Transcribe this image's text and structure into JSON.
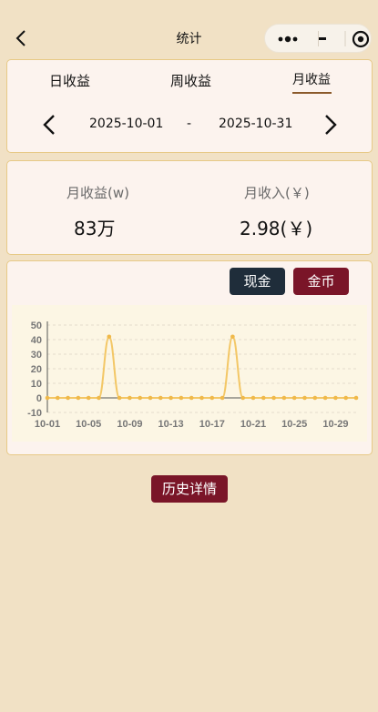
{
  "navbar": {
    "title": "统计",
    "icons": [
      "back-chevron-icon",
      "more-dots-icon",
      "minimize-icon",
      "close-target-icon"
    ]
  },
  "tabs": [
    {
      "label": "日收益",
      "active": false
    },
    {
      "label": "周收益",
      "active": false
    },
    {
      "label": "月收益",
      "active": true
    }
  ],
  "date_range": {
    "start": "2025-10-01",
    "separator": "-",
    "end": "2025-10-31"
  },
  "stats": {
    "left_label": "月收益(w)",
    "left_value": "83万",
    "right_label": "月收入(￥)",
    "right_value": "2.98(￥)"
  },
  "toggle": {
    "cash_label": "现金",
    "coin_label": "金币"
  },
  "chart_data": {
    "type": "line",
    "x": [
      "10-01",
      "10-02",
      "10-03",
      "10-04",
      "10-05",
      "10-06",
      "10-07",
      "10-08",
      "10-09",
      "10-10",
      "10-11",
      "10-12",
      "10-13",
      "10-14",
      "10-15",
      "10-16",
      "10-17",
      "10-18",
      "10-19",
      "10-20",
      "10-21",
      "10-22",
      "10-23",
      "10-24",
      "10-25",
      "10-26",
      "10-27",
      "10-28",
      "10-29",
      "10-30",
      "10-31"
    ],
    "series": [
      {
        "values": [
          0,
          0,
          0,
          0,
          0,
          0,
          42,
          0,
          0,
          0,
          0,
          0,
          0,
          0,
          0,
          0,
          0,
          0,
          42,
          0,
          0,
          0,
          0,
          0,
          0,
          0,
          0,
          0,
          0,
          0,
          0
        ]
      }
    ],
    "xticks": [
      "10-01",
      "10-05",
      "10-09",
      "10-13",
      "10-17",
      "10-21",
      "10-25",
      "10-29"
    ],
    "yticks": [
      -10,
      0,
      10,
      20,
      30,
      40,
      50
    ],
    "ylim": [
      -10,
      50
    ],
    "grid": true,
    "line_color": "#f3c766",
    "point_color": "#f0b94a"
  },
  "history": {
    "label": "历史详情"
  },
  "colors": {
    "background": "#f1e1c5",
    "card_bg": "#fcf3ee",
    "card_border": "#e7c986",
    "accent_dark": "#1f2d3a",
    "accent_red": "#7a1528"
  }
}
